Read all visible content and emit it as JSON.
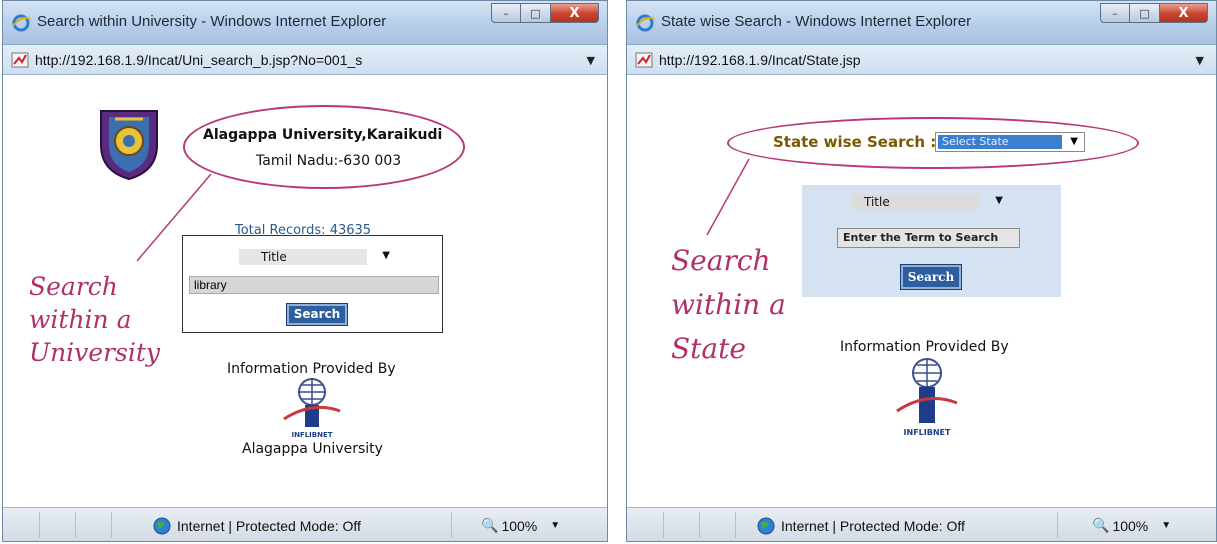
{
  "left_window": {
    "title": "Search within University - Windows Internet Explorer",
    "window_buttons": {
      "minimize": "–",
      "maximize": "□",
      "close": "X"
    },
    "address": "http://192.168.1.9/Incat/Uni_search_b.jsp?No=001_s",
    "university_name": "Alagappa University,Karaikudi",
    "university_address": "Tamil Nadu:-630 003",
    "total_records": "Total Records: 43635",
    "search_field_select": "Title",
    "search_input_value": "library",
    "search_button": "Search",
    "info_provided_by": "Information Provided By",
    "infonet_label": "INFLIBNET",
    "bottom_label": "Alagappa University",
    "status_text": "Internet | Protected Mode: Off",
    "zoom": "100%",
    "annotation": [
      "Search",
      "within a",
      "University"
    ]
  },
  "right_window": {
    "title": "State wise Search - Windows Internet Explorer",
    "window_buttons": {
      "minimize": "–",
      "maximize": "□",
      "close": "X"
    },
    "address": "http://192.168.1.9/Incat/State.jsp",
    "state_label": "State wise Search :",
    "state_select": "Select State",
    "search_field_select": "Title",
    "search_input_placeholder": "Enter the Term to Search",
    "search_button": "Search",
    "info_provided_by": "Information Provided By",
    "infonet_label": "INFLIBNET",
    "status_text": "Internet | Protected Mode: Off",
    "zoom": "100%",
    "annotation": [
      "Search",
      "within a",
      "State"
    ]
  },
  "colors": {
    "annotation": "#b0306a",
    "button": "#2c5ea0",
    "link_text": "#2a5a8a",
    "state_label": "#7a5a00"
  }
}
